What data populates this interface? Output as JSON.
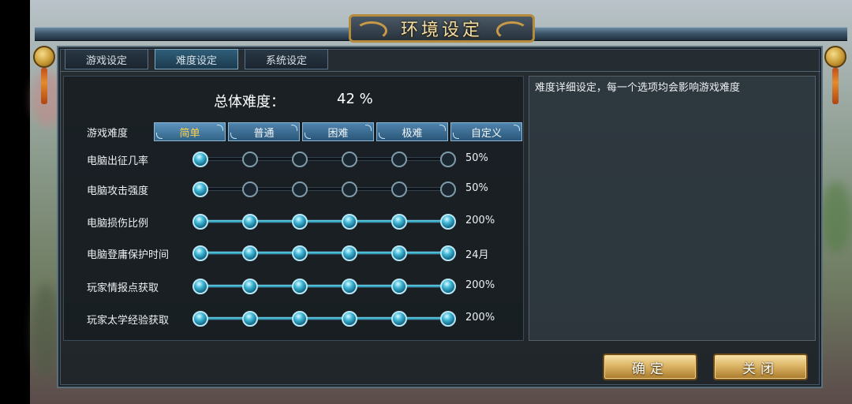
{
  "window": {
    "title": "环境设定"
  },
  "tabs": [
    {
      "label": "游戏设定",
      "active": false
    },
    {
      "label": "难度设定",
      "active": true
    },
    {
      "label": "系统设定",
      "active": false
    }
  ],
  "overall": {
    "label": "总体难度：",
    "value": "42 %"
  },
  "difficulty": {
    "label": "游戏难度",
    "options": [
      "简单",
      "普通",
      "困难",
      "极难",
      "自定义"
    ],
    "selected": "简单"
  },
  "sliders": [
    {
      "label": "电脑出征几率",
      "value": "50%",
      "level": 1,
      "steps": 6
    },
    {
      "label": "电脑攻击强度",
      "value": "50%",
      "level": 1,
      "steps": 6
    },
    {
      "label": "电脑损伤比例",
      "value": "200%",
      "level": 6,
      "steps": 6
    },
    {
      "label": "电脑登庸保护时间",
      "value": "24月",
      "level": 6,
      "steps": 6
    },
    {
      "label": "玩家情报点获取",
      "value": "200%",
      "level": 6,
      "steps": 6
    },
    {
      "label": "玩家太学经验获取",
      "value": "200%",
      "level": 6,
      "steps": 6
    }
  ],
  "description": {
    "text": "难度详细设定，每一个选项均会影响游戏难度"
  },
  "buttons": {
    "confirm": "确定",
    "close": "关闭"
  },
  "colors": {
    "accent": "#2f5e78",
    "gold": "#dcb566",
    "selected_text": "#ffd24a"
  }
}
